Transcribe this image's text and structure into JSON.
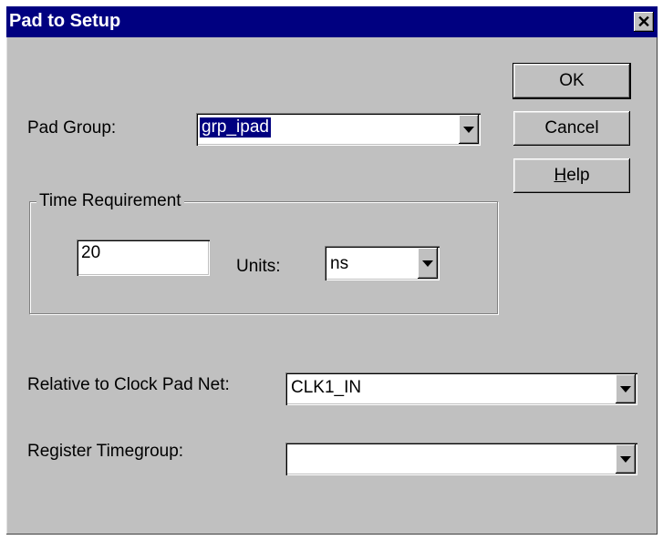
{
  "window": {
    "title": "Pad to Setup",
    "close_glyph": "✕"
  },
  "buttons": {
    "ok": "OK",
    "cancel": "Cancel",
    "help_mnemonic": "H",
    "help_rest": "elp"
  },
  "pad_group": {
    "label": "Pad Group:",
    "value": "grp_ipad"
  },
  "time_requirement": {
    "title": "Time Requirement",
    "value": "20",
    "units_label": "Units:",
    "units_value": "ns"
  },
  "clock_pad_net": {
    "label": "Relative to Clock Pad Net:",
    "value": "CLK1_IN"
  },
  "register_timegroup": {
    "label": "Register Timegroup:",
    "value": ""
  },
  "icons": [
    "close-icon",
    "dropdown-arrow-icon"
  ]
}
